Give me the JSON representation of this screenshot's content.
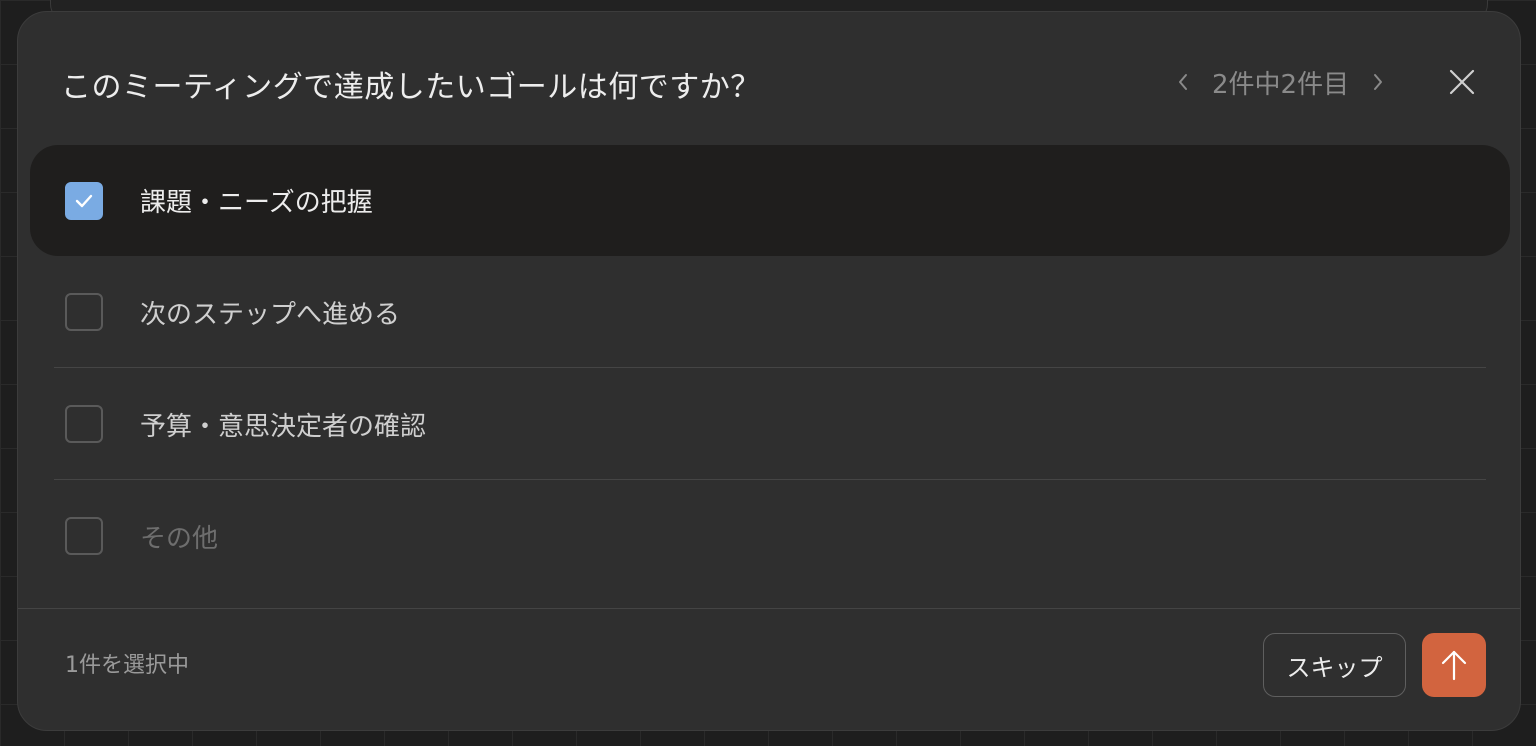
{
  "dialog": {
    "title": "このミーティングで達成したいゴールは何ですか？",
    "pager": {
      "text": "2件中2件目",
      "prev_icon": "chevron-left-icon",
      "next_icon": "chevron-right-icon"
    },
    "close_icon": "close-icon"
  },
  "options": [
    {
      "label": "課題・ニーズの把握",
      "checked": true
    },
    {
      "label": "次のステップへ進める",
      "checked": false
    },
    {
      "label": "予算・意思決定者の確認",
      "checked": false
    },
    {
      "label": "その他",
      "checked": false
    }
  ],
  "footer": {
    "selected_count": "1件を選択中",
    "skip_label": "スキップ",
    "submit_icon": "arrow-up-icon"
  },
  "colors": {
    "accent_submit": "#d2643f",
    "checkbox_checked": "#7aabe3",
    "dialog_bg": "#2f2f2f",
    "selected_row_bg": "#1f1e1d"
  }
}
